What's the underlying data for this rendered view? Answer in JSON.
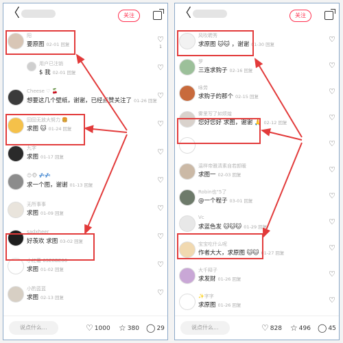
{
  "ui": {
    "follow_label": "关注",
    "back_glyph": "〈",
    "input_placeholder": "说点什么..."
  },
  "left": {
    "comments": [
      {
        "user": "阳",
        "text": "要原图",
        "meta": "02-01 回复",
        "like": "1",
        "avatar_color": "#d8c6b6"
      },
      {
        "user": "用户已注销",
        "text": "$ 我",
        "meta": "02-01 回复",
        "like": "",
        "avatar_color": "#cfcfcf",
        "sub": true
      },
      {
        "user": "Cheese ♡ 🍒",
        "text": "想要这几个壁纸，谢谢，已经点赞关注了",
        "meta": "01-26 回复",
        "like": "",
        "avatar_color": "#3b3b3b"
      },
      {
        "user": "囧囧无放大努力 🍔",
        "text": "求图 🐱",
        "meta": "01-24 回复",
        "like": "",
        "avatar_color": "#f5c14a"
      },
      {
        "user": "九字",
        "text": "求图",
        "meta": "01-17 回复",
        "like": "",
        "avatar_color": "#2a2a2a"
      },
      {
        "user": "😊🐵 💤💤",
        "text": "求一个图，谢谢",
        "meta": "01-13 回复",
        "like": "",
        "avatar_color": "#8c8c8c"
      },
      {
        "user": "无所事事",
        "text": "求图",
        "meta": "01-09 回复",
        "like": "",
        "avatar_color": "#e9e4dc"
      },
      {
        "user": "sadxheer",
        "text": "好羡欢 求图",
        "meta": "03-02 回复",
        "like": "",
        "avatar_color": "#1e1e1e"
      },
      {
        "user": "小红薯 63E8BE06",
        "text": "求图",
        "meta": "01-02 回复",
        "like": "",
        "avatar_color": "#ffffff"
      },
      {
        "user": "小酌蓝蓝",
        "text": "求图",
        "meta": "02-13 回复",
        "like": "",
        "avatar_color": "#d7cfc4"
      }
    ],
    "bottom": {
      "likes": "1000",
      "stars": "380",
      "comments": "29"
    }
  },
  "right": {
    "comments": [
      {
        "user": "风吹聘秀",
        "text": "求原图 🐱🐱 ，谢谢",
        "meta": "01-30 回复",
        "like": "",
        "avatar_color": "#f2f2f2"
      },
      {
        "user": "罗",
        "text": "三连求购子",
        "meta": "02-16 回复",
        "like": "",
        "avatar_color": "#9cc09a"
      },
      {
        "user": "咏劳",
        "text": "求购子的那个",
        "meta": "02-15 回复",
        "like": "",
        "avatar_color": "#c86a3c"
      },
      {
        "user": "雾里写了如烦煌",
        "text": "您好您好 求图，谢谢 🙏",
        "meta": "02-12 回复",
        "like": "",
        "avatar_color": "#d9d2cc"
      },
      {
        "user": "",
        "text": "",
        "meta": "",
        "like": "",
        "avatar_color": "#ffffff"
      },
      {
        "user": "温样帝雅清素自若颜暖",
        "text": "求图一",
        "meta": "02-03 回复",
        "like": "",
        "avatar_color": "#cbb9a6"
      },
      {
        "user": "Robin也\"5了",
        "text": "@一个程子",
        "meta": "03-01 回复",
        "like": "",
        "avatar_color": "#6d7a6a"
      },
      {
        "user": "Vc",
        "text": "求蓝色发 🐱🐱🐱",
        "meta": "01-29 回复",
        "like": "",
        "avatar_color": "#e8e8e8"
      },
      {
        "user": "宝宝吃什么呢",
        "text": "作者大大，求原图 🐱🐱",
        "meta": "01-27 回复",
        "like": "",
        "avatar_color": "#f1d9b0"
      },
      {
        "user": "大千释子",
        "text": "求发财",
        "meta": "01-26 回复",
        "like": "",
        "avatar_color": "#c9a7d6"
      },
      {
        "user": "✨字字",
        "text": "求原图",
        "meta": "01-26 回复",
        "like": "",
        "avatar_color": "#ffffff"
      }
    ],
    "bottom": {
      "likes": "828",
      "stars": "496",
      "comments": "45"
    }
  }
}
